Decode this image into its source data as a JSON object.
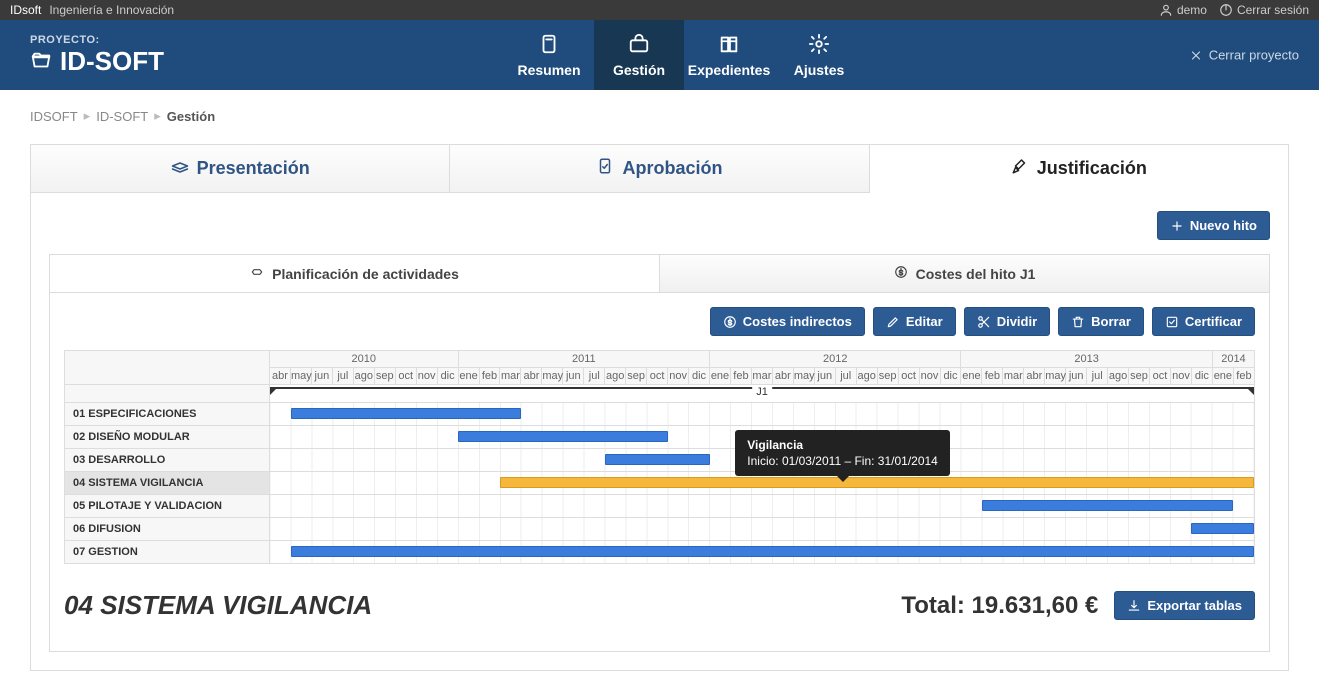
{
  "topbar": {
    "brand": "IDsoft",
    "tagline": "Ingeniería e Innovación",
    "user": "demo",
    "logout": "Cerrar sesión"
  },
  "header": {
    "project_label": "PROYECTO:",
    "project_name": "ID-SOFT",
    "tabs": [
      "Resumen",
      "Gestión",
      "Expedientes",
      "Ajustes"
    ],
    "active_tab_index": 1,
    "close_project": "Cerrar proyecto"
  },
  "breadcrumb": [
    "IDSOFT",
    "ID-SOFT",
    "Gestión"
  ],
  "main_tabs": {
    "items": [
      "Presentación",
      "Aprobación",
      "Justificación"
    ],
    "active_index": 2
  },
  "buttons": {
    "new_milestone": "Nuevo hito",
    "indirect_costs": "Costes indirectos",
    "edit": "Editar",
    "split": "Dividir",
    "delete": "Borrar",
    "certify": "Certificar",
    "export_tables": "Exportar tablas"
  },
  "subtabs": {
    "items": [
      "Planificación de actividades",
      "Costes del hito J1"
    ],
    "active_index": 0
  },
  "chart_data": {
    "type": "gantt",
    "years": [
      {
        "label": "2010",
        "months": [
          "abr",
          "may",
          "jun",
          "jul",
          "ago",
          "sep",
          "oct",
          "nov",
          "dic"
        ]
      },
      {
        "label": "2011",
        "months": [
          "ene",
          "feb",
          "mar",
          "abr",
          "may",
          "jun",
          "jul",
          "ago",
          "sep",
          "oct",
          "nov",
          "dic"
        ]
      },
      {
        "label": "2012",
        "months": [
          "ene",
          "feb",
          "mar",
          "abr",
          "may",
          "jun",
          "jul",
          "ago",
          "sep",
          "oct",
          "nov",
          "dic"
        ]
      },
      {
        "label": "2013",
        "months": [
          "ene",
          "feb",
          "mar",
          "abr",
          "may",
          "jun",
          "jul",
          "ago",
          "sep",
          "oct",
          "nov",
          "dic"
        ]
      },
      {
        "label": "2014",
        "months": [
          "ene",
          "feb"
        ]
      }
    ],
    "total_months": 47,
    "milestone": {
      "label": "J1",
      "start_idx": 0,
      "span": 47
    },
    "activities": [
      {
        "label": "01 ESPECIFICACIONES",
        "start_idx": 1,
        "span": 11,
        "highlight": false
      },
      {
        "label": "02 DISEÑO MODULAR",
        "start_idx": 9,
        "span": 10,
        "highlight": false
      },
      {
        "label": "03 DESARROLLO",
        "start_idx": 16,
        "span": 5,
        "highlight": false
      },
      {
        "label": "04 SISTEMA VIGILANCIA",
        "start_idx": 11,
        "span": 36,
        "highlight": true,
        "color": "orange"
      },
      {
        "label": "05 PILOTAJE Y VALIDACION",
        "start_idx": 34,
        "span": 12,
        "highlight": false
      },
      {
        "label": "06 DIFUSION",
        "start_idx": 44,
        "span": 3,
        "highlight": false
      },
      {
        "label": "07 GESTION",
        "start_idx": 1,
        "span": 46,
        "highlight": false
      }
    ],
    "tooltip": {
      "title": "Vigilancia",
      "detail": "Inicio: 01/03/2011 – Fin: 31/01/2014",
      "activity_idx": 3,
      "month_idx": 27
    }
  },
  "footer": {
    "activity_title": "04 SISTEMA VIGILANCIA",
    "total_label": "Total:",
    "total_value": "19.631,60 €"
  }
}
